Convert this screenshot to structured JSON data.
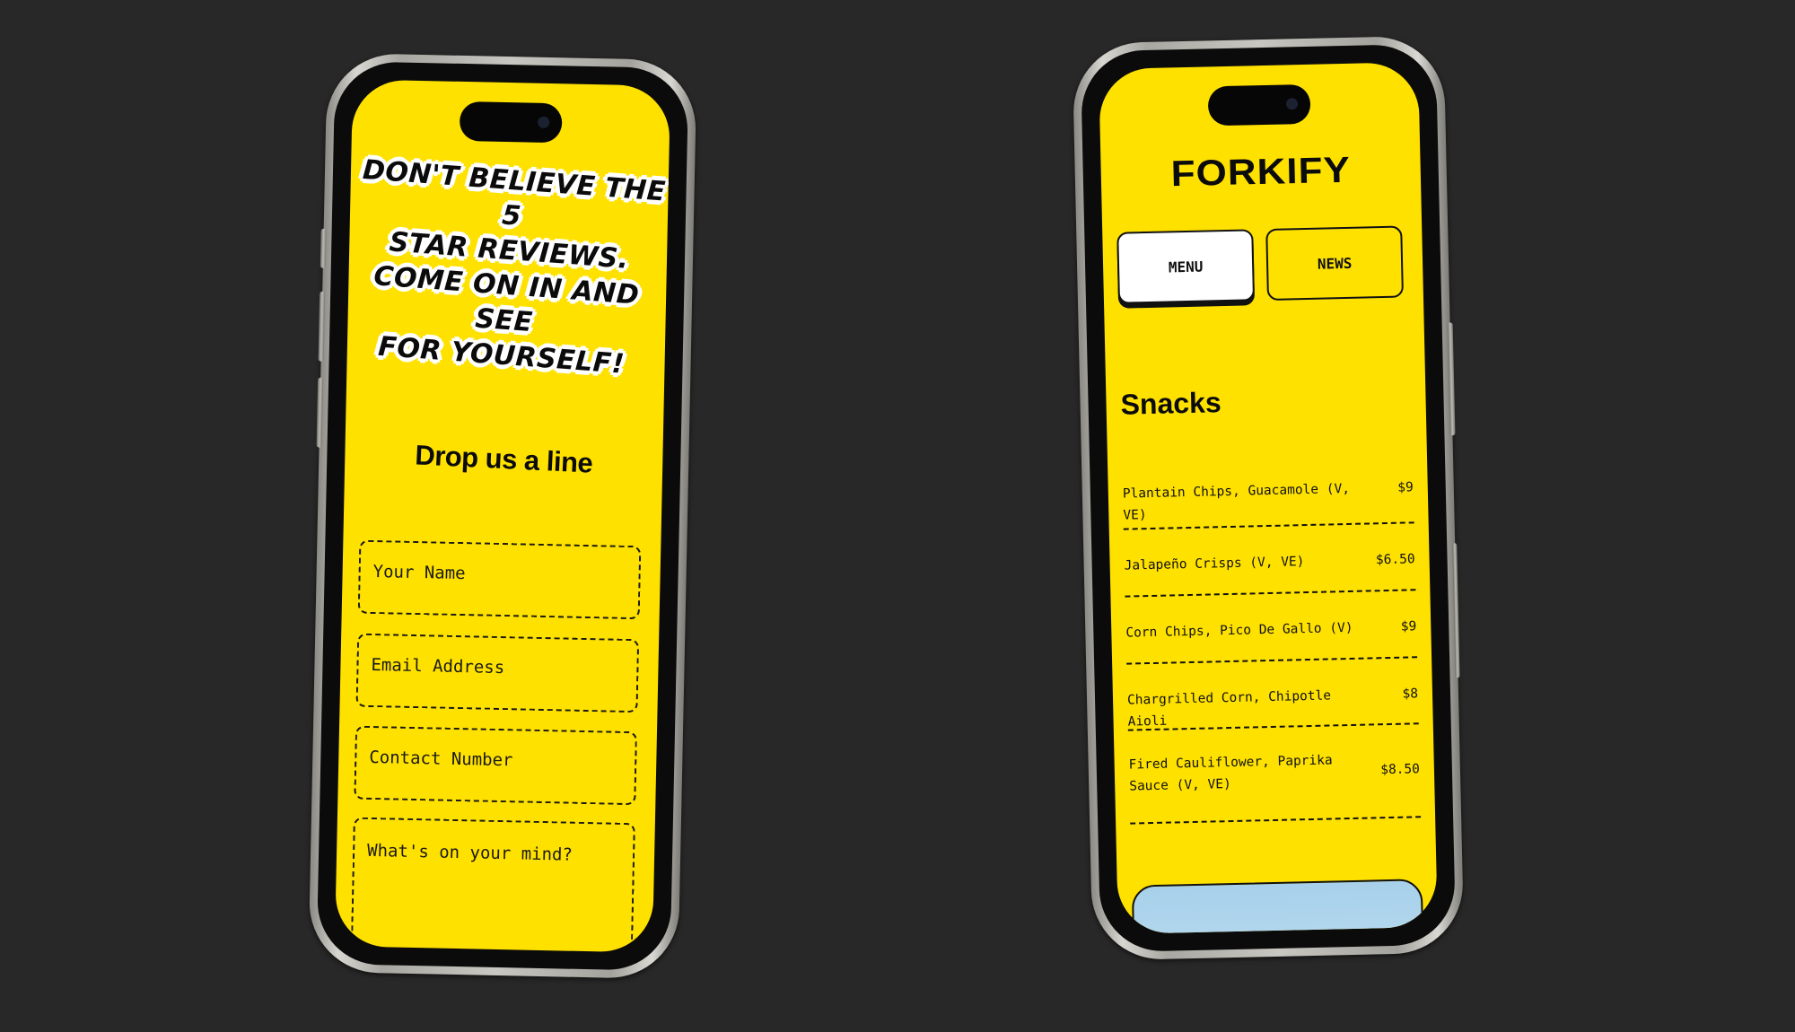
{
  "contact_screen": {
    "slogan_lines": [
      "Don't believe the 5",
      "star reviews.",
      "Come on in and see",
      "for yourself!"
    ],
    "form_title": "Drop us a line",
    "fields": {
      "name_placeholder": "Your Name",
      "email_placeholder": "Email Address",
      "phone_placeholder": "Contact Number",
      "message_placeholder": "What's on your mind?"
    }
  },
  "menu_screen": {
    "brand": "FORKIFY",
    "tabs": {
      "menu": "MENU",
      "news": "NEWS"
    },
    "section_title": "Snacks",
    "items": [
      {
        "name": "Plantain Chips, Guacamole (V, VE)",
        "price": "$9"
      },
      {
        "name": "Jalapeño Crisps (V, VE)",
        "price": "$6.50"
      },
      {
        "name": "Corn Chips, Pico De Gallo (V)",
        "price": "$9"
      },
      {
        "name": "Chargrilled Corn, Chipotle Aioli",
        "price": "$8"
      },
      {
        "name": "Fired Cauliflower, Paprika Sauce (V, VE)",
        "price": "$8.50"
      }
    ]
  },
  "colors": {
    "background": "#282828",
    "screen_yellow": "#ffe100",
    "ink": "#0b0b0b",
    "frame": "#c9c7c1"
  }
}
